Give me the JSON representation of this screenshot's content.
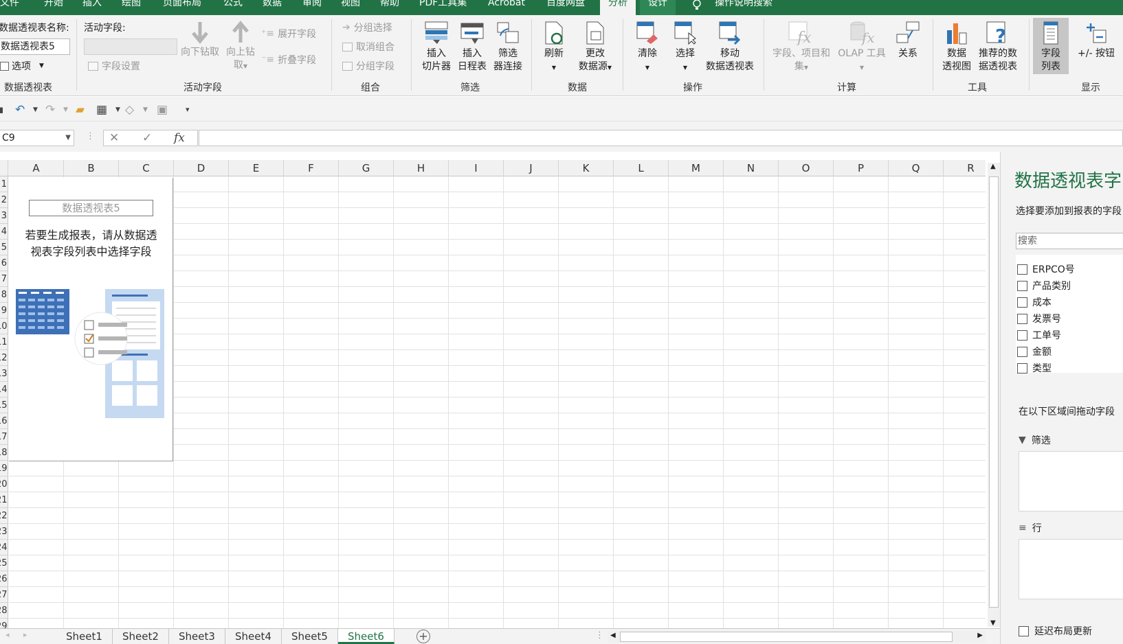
{
  "menu": {
    "items": [
      "文件",
      "开始",
      "插入",
      "绘图",
      "页面布局",
      "公式",
      "数据",
      "审阅",
      "视图",
      "帮助",
      "PDF工具集",
      "Acrobat",
      "百度网盘",
      "分析",
      "设计"
    ],
    "active": "分析",
    "tell_me": "操作说明搜索"
  },
  "ribbon": {
    "pivot_group": {
      "name_label": "数据透视表名称:",
      "name_value": "数据透视表5",
      "options_label": "选项",
      "group_label": "数据透视表"
    },
    "active_field_group": {
      "field_label": "活动字段:",
      "field_value": "",
      "settings_label": "字段设置",
      "drill_down": "向下钻取",
      "drill_up_line1": "向上钻",
      "drill_up_line2": "取",
      "expand": "展开字段",
      "collapse": "折叠字段",
      "group_label": "活动字段"
    },
    "group_group": {
      "group_selection": "分组选择",
      "ungroup": "取消组合",
      "group_field": "分组字段",
      "group_label": "组合"
    },
    "filter_group": {
      "slicer_l1": "插入",
      "slicer_l2": "切片器",
      "timeline_l1": "插入",
      "timeline_l2": "日程表",
      "conn_l1": "筛选",
      "conn_l2": "器连接",
      "group_label": "筛选"
    },
    "data_group": {
      "refresh": "刷新",
      "change_l1": "更改",
      "change_l2": "数据源",
      "group_label": "数据"
    },
    "actions_group": {
      "clear": "清除",
      "select": "选择",
      "move_l1": "移动",
      "move_l2": "数据透视表",
      "group_label": "操作"
    },
    "calc_group": {
      "fields_l1": "字段、项目和",
      "fields_l2": "集",
      "olap": "OLAP 工具",
      "relations": "关系",
      "group_label": "计算"
    },
    "tools_group": {
      "chart_l1": "数据",
      "chart_l2": "透视图",
      "rec_l1": "推荐的数",
      "rec_l2": "据透视表",
      "group_label": "工具"
    },
    "show_group": {
      "fieldlist_l1": "字段",
      "fieldlist_l2": "列表",
      "buttons": "+/- 按钮",
      "group_label": "显示"
    }
  },
  "formula_bar": {
    "name_box": "C9",
    "fx": "fx",
    "value": ""
  },
  "grid": {
    "columns": [
      "A",
      "B",
      "C",
      "D",
      "E",
      "F",
      "G",
      "H",
      "I",
      "J",
      "K",
      "L",
      "M",
      "N",
      "O",
      "P",
      "Q",
      "R"
    ],
    "rows": [
      "1",
      "2",
      "3",
      "4",
      "5",
      "6",
      "7",
      "8",
      "9",
      "10",
      "11",
      "12",
      "13",
      "14",
      "15",
      "16",
      "17",
      "18",
      "19",
      "20",
      "21",
      "22",
      "23",
      "24",
      "25",
      "26",
      "27",
      "28",
      "29"
    ]
  },
  "pivot_placeholder": {
    "name": "数据透视表5",
    "message_line1": "若要生成报表，请从数据透",
    "message_line2": "视表字段列表中选择字段"
  },
  "sheets": {
    "tabs": [
      "Sheet1",
      "Sheet2",
      "Sheet3",
      "Sheet4",
      "Sheet5",
      "Sheet6"
    ],
    "active": "Sheet6"
  },
  "field_pane": {
    "title": "数据透视表字",
    "subtitle": "选择要添加到报表的字段",
    "search_placeholder": "搜索",
    "fields": [
      "ERPCO号",
      "产品类别",
      "成本",
      "发票号",
      "工单号",
      "金额",
      "类型"
    ],
    "drag_hint": "在以下区域间拖动字段",
    "zones": {
      "filter": "筛选",
      "rows": "行"
    },
    "defer_label": "延迟布局更新"
  },
  "colors": {
    "accent": "#217346",
    "ribbon_bg": "#f3f3f3",
    "grid_line": "#e1e1e1"
  }
}
